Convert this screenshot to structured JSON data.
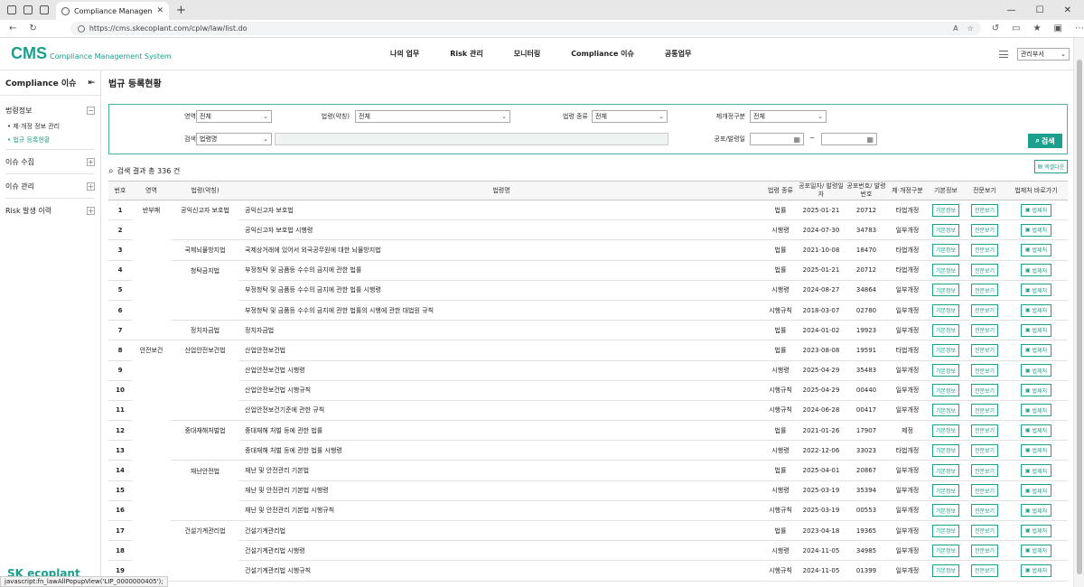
{
  "browser": {
    "tab_title": "Compliance Management System",
    "url": "https://cms.skecoplant.com/cplw/law/list.do"
  },
  "header": {
    "logo_main": "CMS",
    "logo_sub": "Compliance Management System",
    "nav": [
      "나의 업무",
      "Risk 관리",
      "모니터링",
      "Compliance 이슈",
      "공통업무"
    ],
    "dept": "관리부서"
  },
  "sidebar": {
    "title": "Compliance 이슈",
    "groups": [
      {
        "label": "법령정보",
        "toggle": "−",
        "items": [
          {
            "label": "제·개정 정보 관리",
            "active": false
          },
          {
            "label": "법규 등록현황",
            "active": true
          }
        ]
      },
      {
        "label": "이슈 수집",
        "toggle": "+",
        "items": []
      },
      {
        "label": "이슈 관리",
        "toggle": "+",
        "items": []
      },
      {
        "label": "Risk 발생 이력",
        "toggle": "+",
        "items": []
      }
    ],
    "footer_logo": "SK ecoplant"
  },
  "main": {
    "page_title": "법규 등록현황",
    "filters": {
      "area_label": "영역",
      "area_value": "전체",
      "law_label": "법령(약칭)",
      "law_value": "전체",
      "kind_label": "법령 종류",
      "kind_value": "전체",
      "rev_label": "제개정구분",
      "rev_value": "전체",
      "search_label": "검색",
      "search_field_value": "법령명",
      "date_label": "공포/발령일",
      "date_sep": "~",
      "search_button": "검색"
    },
    "result_text": "검색 결과 총 336 건",
    "excel_button": "엑셀다운",
    "columns": [
      "번호",
      "영역",
      "법령(약칭)",
      "법령명",
      "법령 종류",
      "공포일자/ 발령일자",
      "공포번호/ 발령번호",
      "제·개정구분",
      "기본정보",
      "전문보기",
      "법제처 바로가기"
    ],
    "btn_labels": {
      "basic": "기본정보",
      "full": "전문보기",
      "moleg": "법제처"
    },
    "rows": [
      {
        "no": "1",
        "area": "반부패",
        "law": "공익신고자 보호법",
        "name": "공익신고자 보호법",
        "kind": "법률",
        "date": "2025-01-21",
        "num": "20712",
        "rev": "타법개정"
      },
      {
        "no": "2",
        "area": "",
        "law": "",
        "name": "공익신고자 보호법 시행령",
        "kind": "시행령",
        "date": "2024-07-30",
        "num": "34783",
        "rev": "일부개정"
      },
      {
        "no": "3",
        "area": "",
        "law": "국제뇌물방지법",
        "name": "국제상거래에 있어서 외국공무원에 대한 뇌물방지법",
        "kind": "법률",
        "date": "2021-10-08",
        "num": "18470",
        "rev": "타법개정"
      },
      {
        "no": "4",
        "area": "",
        "law": "청탁금지법",
        "name": "부정청탁 및 금품등 수수의 금지에 관한 법률",
        "kind": "법률",
        "date": "2025-01-21",
        "num": "20712",
        "rev": "타법개정"
      },
      {
        "no": "5",
        "area": "",
        "law": "",
        "name": "부정청탁 및 금품등 수수의 금지에 관한 법률 시행령",
        "kind": "시행령",
        "date": "2024-08-27",
        "num": "34864",
        "rev": "일부개정"
      },
      {
        "no": "6",
        "area": "",
        "law": "",
        "name": "부정청탁 및 금품등 수수의 금지에 관한 법률의 시행에 관한 대법원 규칙",
        "kind": "시행규칙",
        "date": "2018-03-07",
        "num": "02780",
        "rev": "일부개정"
      },
      {
        "no": "7",
        "area": "",
        "law": "정치자금법",
        "name": "정치자금법",
        "kind": "법률",
        "date": "2024-01-02",
        "num": "19923",
        "rev": "일부개정"
      },
      {
        "no": "8",
        "area": "안전보건",
        "law": "산업안전보건법",
        "name": "산업안전보건법",
        "kind": "법률",
        "date": "2023-08-08",
        "num": "19591",
        "rev": "타법개정"
      },
      {
        "no": "9",
        "area": "",
        "law": "",
        "name": "산업안전보건법 시행령",
        "kind": "시행령",
        "date": "2025-04-29",
        "num": "35483",
        "rev": "일부개정"
      },
      {
        "no": "10",
        "area": "",
        "law": "",
        "name": "산업안전보건법 시행규칙",
        "kind": "시행규칙",
        "date": "2025-04-29",
        "num": "00440",
        "rev": "일부개정"
      },
      {
        "no": "11",
        "area": "",
        "law": "",
        "name": "산업안전보건기준에 관한 규칙",
        "kind": "시행규칙",
        "date": "2024-06-28",
        "num": "00417",
        "rev": "일부개정"
      },
      {
        "no": "12",
        "area": "",
        "law": "중대재해처벌법",
        "name": "중대재해 처벌 등에 관한 법률",
        "kind": "법률",
        "date": "2021-01-26",
        "num": "17907",
        "rev": "제정"
      },
      {
        "no": "13",
        "area": "",
        "law": "",
        "name": "중대재해 처벌 등에 관한 법률 시행령",
        "kind": "시행령",
        "date": "2022-12-06",
        "num": "33023",
        "rev": "타법개정"
      },
      {
        "no": "14",
        "area": "",
        "law": "재난안전법",
        "name": "재난 및 안전관리 기본법",
        "kind": "법률",
        "date": "2025-04-01",
        "num": "20867",
        "rev": "일부개정"
      },
      {
        "no": "15",
        "area": "",
        "law": "",
        "name": "재난 및 안전관리 기본법 시행령",
        "kind": "시행령",
        "date": "2025-03-19",
        "num": "35394",
        "rev": "일부개정"
      },
      {
        "no": "16",
        "area": "",
        "law": "",
        "name": "재난 및 안전관리 기본법 시행규칙",
        "kind": "시행규칙",
        "date": "2025-03-19",
        "num": "00553",
        "rev": "일부개정"
      },
      {
        "no": "17",
        "area": "",
        "law": "건설기계관리법",
        "name": "건설기계관리법",
        "kind": "법률",
        "date": "2023-04-18",
        "num": "19365",
        "rev": "일부개정"
      },
      {
        "no": "18",
        "area": "",
        "law": "",
        "name": "건설기계관리법 시행령",
        "kind": "시행령",
        "date": "2024-11-05",
        "num": "34985",
        "rev": "일부개정"
      },
      {
        "no": "19",
        "area": "",
        "law": "",
        "name": "건설기계관리법 시행규칙",
        "kind": "시행규칙",
        "date": "2024-11-05",
        "num": "01399",
        "rev": "일부개정"
      }
    ]
  },
  "status_bar": "javascript:fn_lawAllPopupView('LIP_0000000405');"
}
